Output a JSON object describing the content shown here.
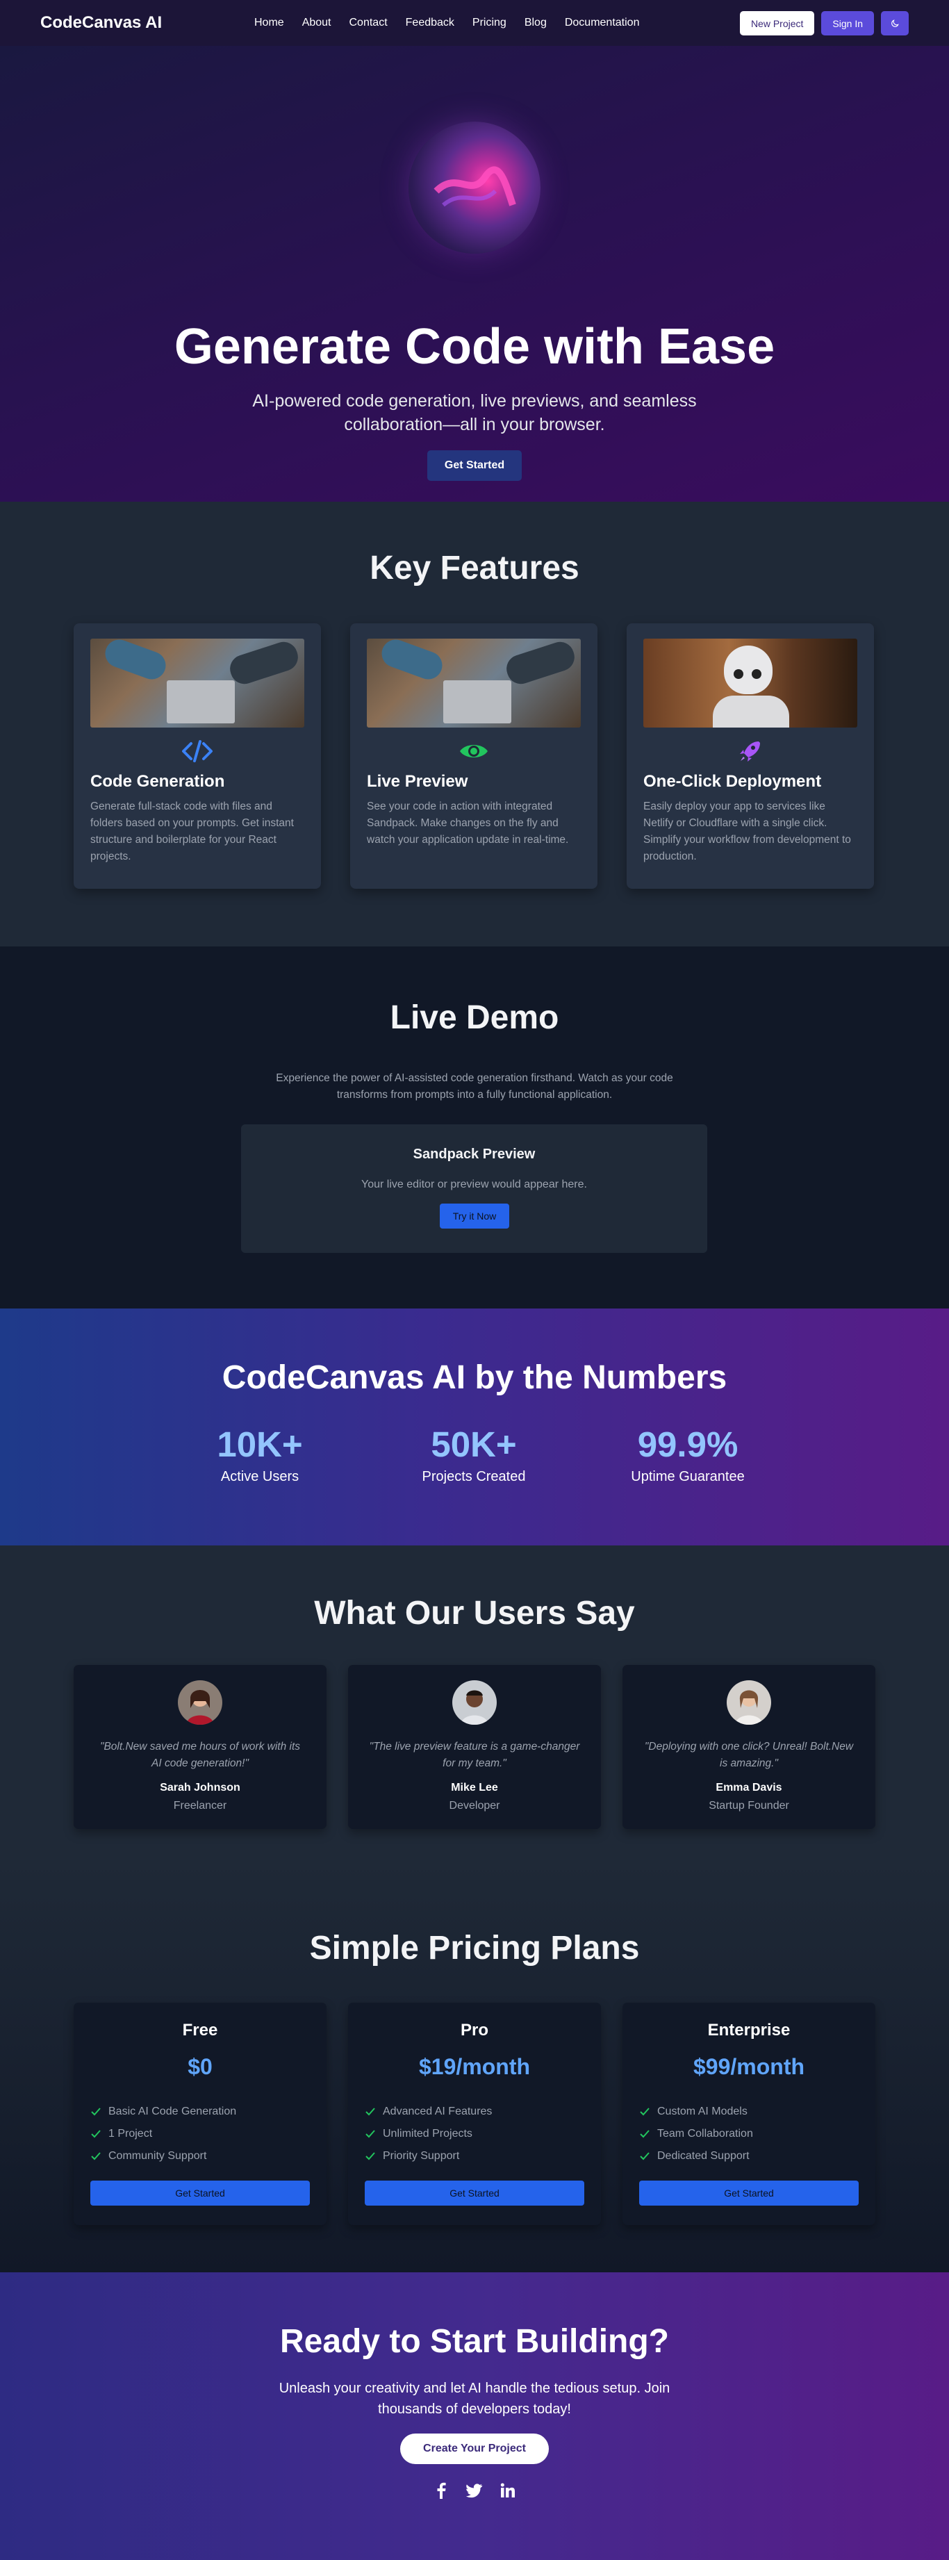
{
  "nav": {
    "brand": "CodeCanvas AI",
    "links": [
      "Home",
      "About",
      "Contact",
      "Feedback",
      "Pricing",
      "Blog",
      "Documentation"
    ],
    "new_project": "New Project",
    "sign_in": "Sign In",
    "theme_icon": "moon-icon"
  },
  "hero": {
    "title": "Generate Code with Ease",
    "subtitle": "AI-powered code generation, live previews, and seamless collaboration—all in your browser.",
    "cta": "Get Started"
  },
  "features": {
    "title": "Key Features",
    "items": [
      {
        "title": "Code Generation",
        "desc": "Generate full-stack code with files and folders based on your prompts. Get instant structure and boilerplate for your React projects.",
        "icon": "code-icon",
        "icon_color": "#3b82f6"
      },
      {
        "title": "Live Preview",
        "desc": "See your code in action with integrated Sandpack. Make changes on the fly and watch your application update in real-time.",
        "icon": "eye-icon",
        "icon_color": "#22c55e"
      },
      {
        "title": "One-Click Deployment",
        "desc": "Easily deploy your app to services like Netlify or Cloudflare with a single click. Simplify your workflow from development to production.",
        "icon": "rocket-icon",
        "icon_color": "#a855f7"
      }
    ]
  },
  "demo": {
    "title": "Live Demo",
    "desc": "Experience the power of AI-assisted code generation firsthand. Watch as your code transforms from prompts into a fully functional application.",
    "box_title": "Sandpack Preview",
    "box_text": "Your live editor or preview would appear here.",
    "button": "Try it Now"
  },
  "stats": {
    "title": "CodeCanvas AI by the Numbers",
    "items": [
      {
        "value": "10K+",
        "label": "Active Users"
      },
      {
        "value": "50K+",
        "label": "Projects Created"
      },
      {
        "value": "99.9%",
        "label": "Uptime Guarantee"
      }
    ]
  },
  "testimonials": {
    "title": "What Our Users Say",
    "items": [
      {
        "quote": "\"Bolt.New saved me hours of work with its AI code generation!\"",
        "name": "Sarah Johnson",
        "role": "Freelancer"
      },
      {
        "quote": "\"The live preview feature is a game-changer for my team.\"",
        "name": "Mike Lee",
        "role": "Developer"
      },
      {
        "quote": "\"Deploying with one click? Unreal! Bolt.New is amazing.\"",
        "name": "Emma Davis",
        "role": "Startup Founder"
      }
    ]
  },
  "pricing": {
    "title": "Simple Pricing Plans",
    "plans": [
      {
        "name": "Free",
        "price": "$0",
        "features": [
          "Basic AI Code Generation",
          "1 Project",
          "Community Support"
        ],
        "button": "Get Started"
      },
      {
        "name": "Pro",
        "price": "$19/month",
        "features": [
          "Advanced AI Features",
          "Unlimited Projects",
          "Priority Support"
        ],
        "button": "Get Started"
      },
      {
        "name": "Enterprise",
        "price": "$99/month",
        "features": [
          "Custom AI Models",
          "Team Collaboration",
          "Dedicated Support"
        ],
        "button": "Get Started"
      }
    ]
  },
  "cta": {
    "title": "Ready to Start Building?",
    "subtitle": "Unleash your creativity and let AI handle the tedious setup. Join thousands of developers today!",
    "button": "Create Your Project",
    "socials": [
      "facebook-icon",
      "twitter-icon",
      "linkedin-icon"
    ]
  }
}
